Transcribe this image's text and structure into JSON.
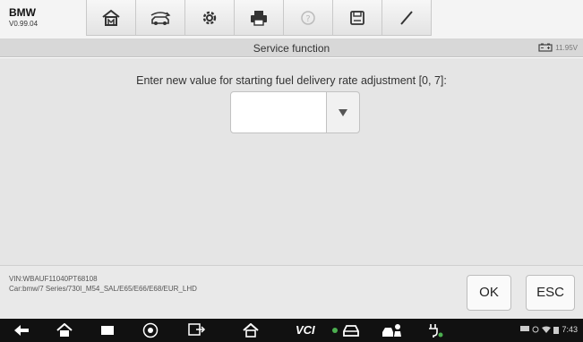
{
  "app": {
    "brand": "BMW",
    "version": "V0.99.04"
  },
  "toolbar": {
    "items": [
      {
        "icon": "home-icon"
      },
      {
        "icon": "vehicle-swap-icon"
      },
      {
        "icon": "settings-icon"
      },
      {
        "icon": "print-icon"
      },
      {
        "icon": "help-icon",
        "disabled": true
      },
      {
        "icon": "save-icon"
      },
      {
        "icon": "edit-pen-icon"
      }
    ]
  },
  "titlebar": {
    "title": "Service function",
    "voltage": "11.95V"
  },
  "main": {
    "prompt": "Enter new value for starting fuel delivery rate adjustment [0, 7]:",
    "input_value": ""
  },
  "footer": {
    "vin": "VIN:WBAUF11040PT68108",
    "car": "Car:bmw/7 Series/730I_M54_SAL/E65/E66/E68/EUR_LHD",
    "ok_label": "OK",
    "esc_label": "ESC"
  },
  "navbar": {
    "vci_label": "VCI",
    "time": "7:43"
  },
  "colors": {
    "accent_green": "#4caf50",
    "toolbar_bg": "#f4f4f4",
    "main_bg": "#e5e5e5"
  }
}
